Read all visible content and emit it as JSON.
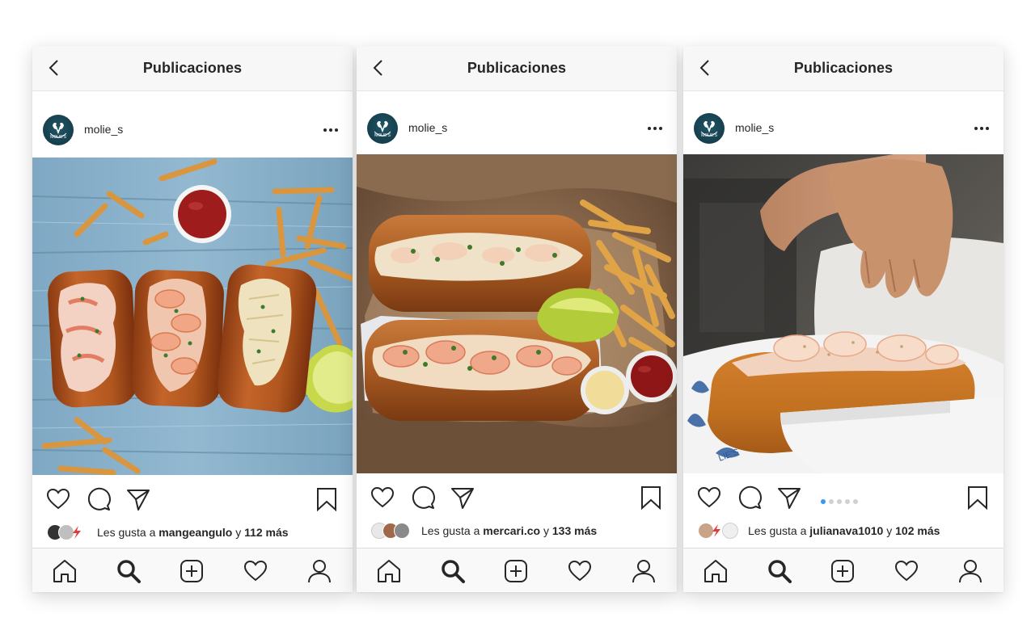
{
  "screens": [
    {
      "header": {
        "title": "Publicaciones"
      },
      "post": {
        "username": "molie_s",
        "avatar_text": "MOLIE'S",
        "photo_description_icon": "lobster-rolls-on-wooden-table",
        "carousel": false,
        "likes": {
          "prefix": "Les gusta a",
          "user": "mangeangulo",
          "conjunction": "y",
          "count": "112 más"
        }
      }
    },
    {
      "header": {
        "title": "Publicaciones"
      },
      "post": {
        "username": "molie_s",
        "avatar_text": "MOLIE'S",
        "photo_description_icon": "lobster-and-shrimp-rolls-with-fries",
        "carousel": false,
        "likes": {
          "prefix": "Les gusta a",
          "user": "mercari.co",
          "conjunction": "y",
          "count": "133 más"
        }
      }
    },
    {
      "header": {
        "title": "Publicaciones"
      },
      "post": {
        "username": "molie_s",
        "avatar_text": "MOLIE'S",
        "photo_description_icon": "hand-seasoning-lobster-roll",
        "carousel": true,
        "carousel_count": 5,
        "carousel_active": 1,
        "likes": {
          "prefix": "Les gusta a",
          "user": "julianava1010",
          "conjunction": "y",
          "count": "102 más"
        }
      }
    }
  ],
  "colors": {
    "accent_blue": "#3897f0",
    "text": "#262626",
    "avatar_bg": "#163f4d"
  },
  "icons": {
    "back": "chevron-left-icon",
    "more": "ellipsis-icon",
    "like": "heart-icon",
    "comment": "comment-bubble-icon",
    "share": "paper-plane-icon",
    "save": "bookmark-icon",
    "nav": [
      "home-icon",
      "search-icon",
      "add-post-icon",
      "activity-heart-icon",
      "profile-icon"
    ]
  }
}
